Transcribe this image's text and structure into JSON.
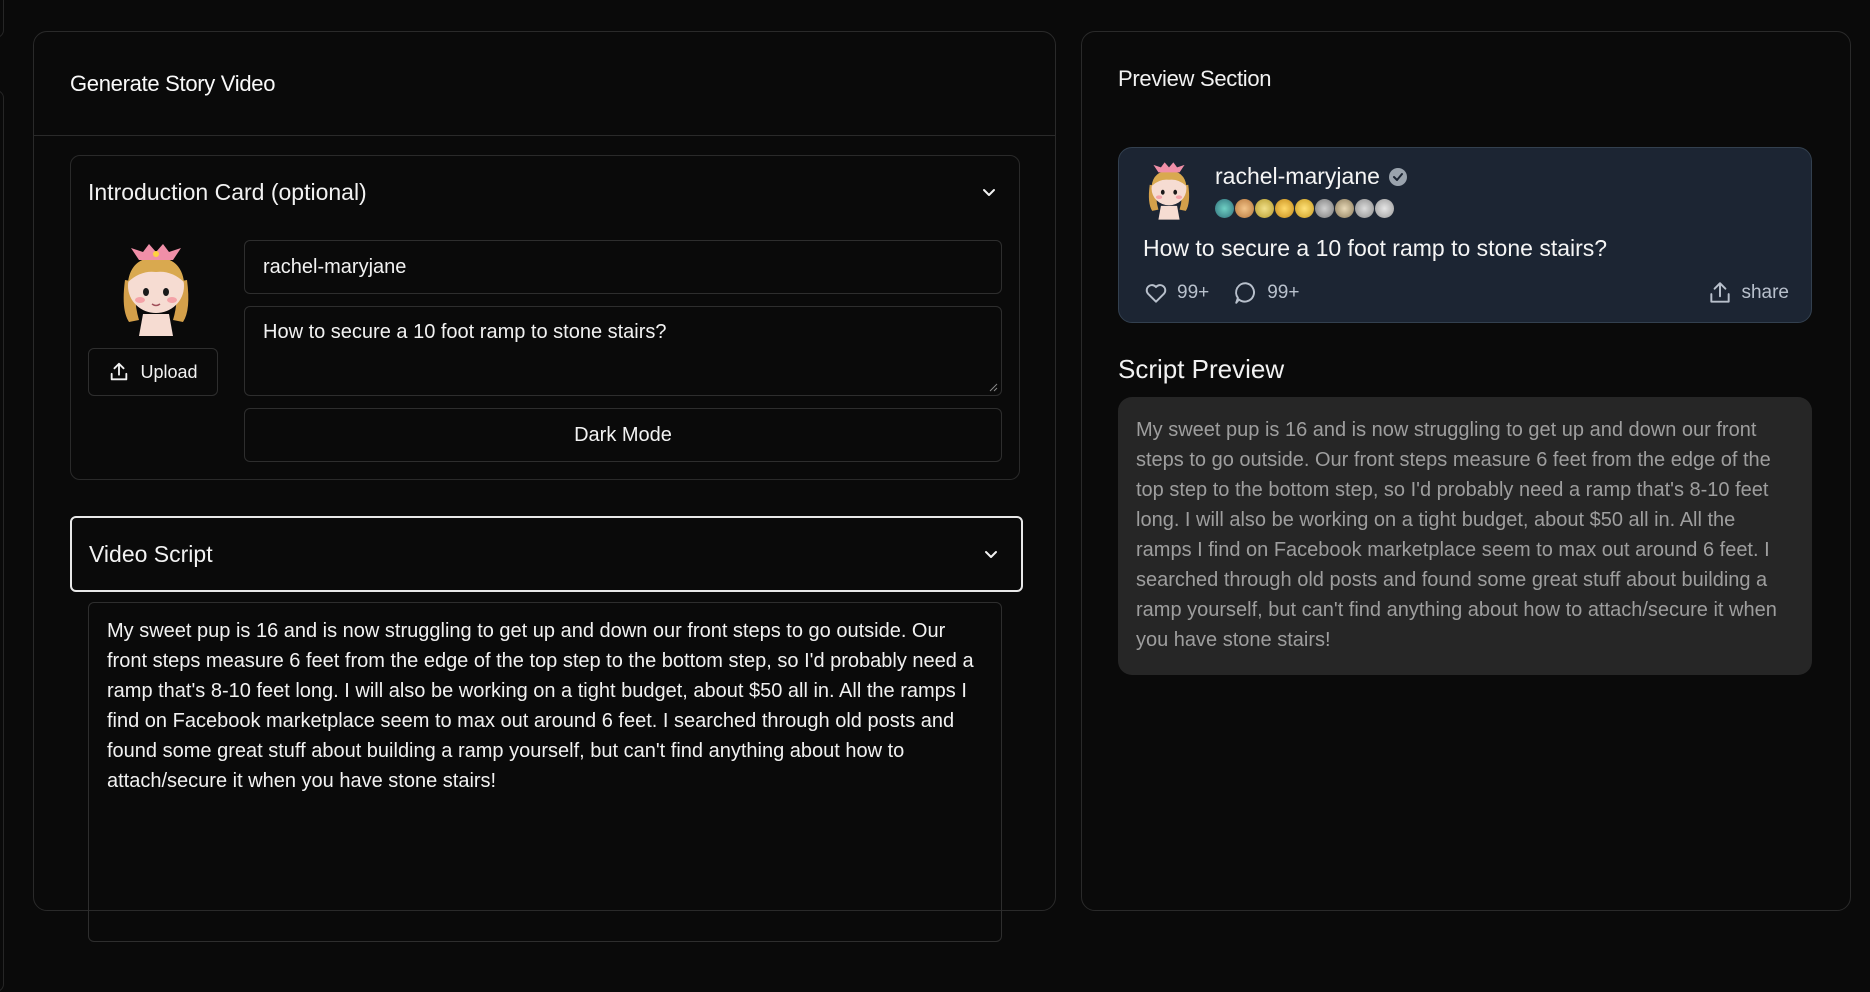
{
  "generator": {
    "title": "Generate Story Video",
    "intro_card": {
      "title": "Introduction Card (optional)",
      "upload_label": "Upload",
      "username_value": "rachel-maryjane",
      "post_title_value": "How to secure a 10 foot ramp to stone stairs?",
      "mode_button_label": "Dark Mode"
    },
    "video_script": {
      "title": "Video Script",
      "text": "My sweet pup is 16 and is now struggling to get up and down our front steps to go outside. Our front steps measure 6 feet from the edge of the top step to the bottom step, so I'd probably need a ramp that's 8-10 feet long. I will also be working on a tight budget, about $50 all in. All the ramps I find on Facebook marketplace seem to max out around 6 feet. I searched through old posts and found some great stuff about building a ramp yourself, but can't find anything about how to attach/secure it when you have stone stairs!"
    }
  },
  "preview": {
    "title": "Preview Section",
    "post": {
      "username": "rachel-maryjane",
      "title": "How to secure a 10 foot ramp to stone stairs?",
      "likes": "99+",
      "comments": "99+",
      "share_label": "share",
      "card_color": "#1c2533"
    },
    "script_preview": {
      "title": "Script Preview",
      "text": "My sweet pup is 16 and is now struggling to get up and down our front steps to go outside. Our front steps measure 6 feet from the edge of the top step to the bottom step, so I'd probably need a ramp that's 8-10 feet long. I will also be working on a tight budget, about $50 all in. All the ramps I find on Facebook marketplace seem to max out around 6 feet. I searched through old posts and found some great stuff about building a ramp yourself, but can't find anything about how to attach/secure it when you have stone stairs!"
    }
  },
  "icons": {
    "chevron": "chevron-down-icon",
    "upload": "upload-icon",
    "verified": "verified-badge-icon",
    "like": "heart-icon",
    "comment": "comment-icon",
    "share": "share-icon"
  }
}
